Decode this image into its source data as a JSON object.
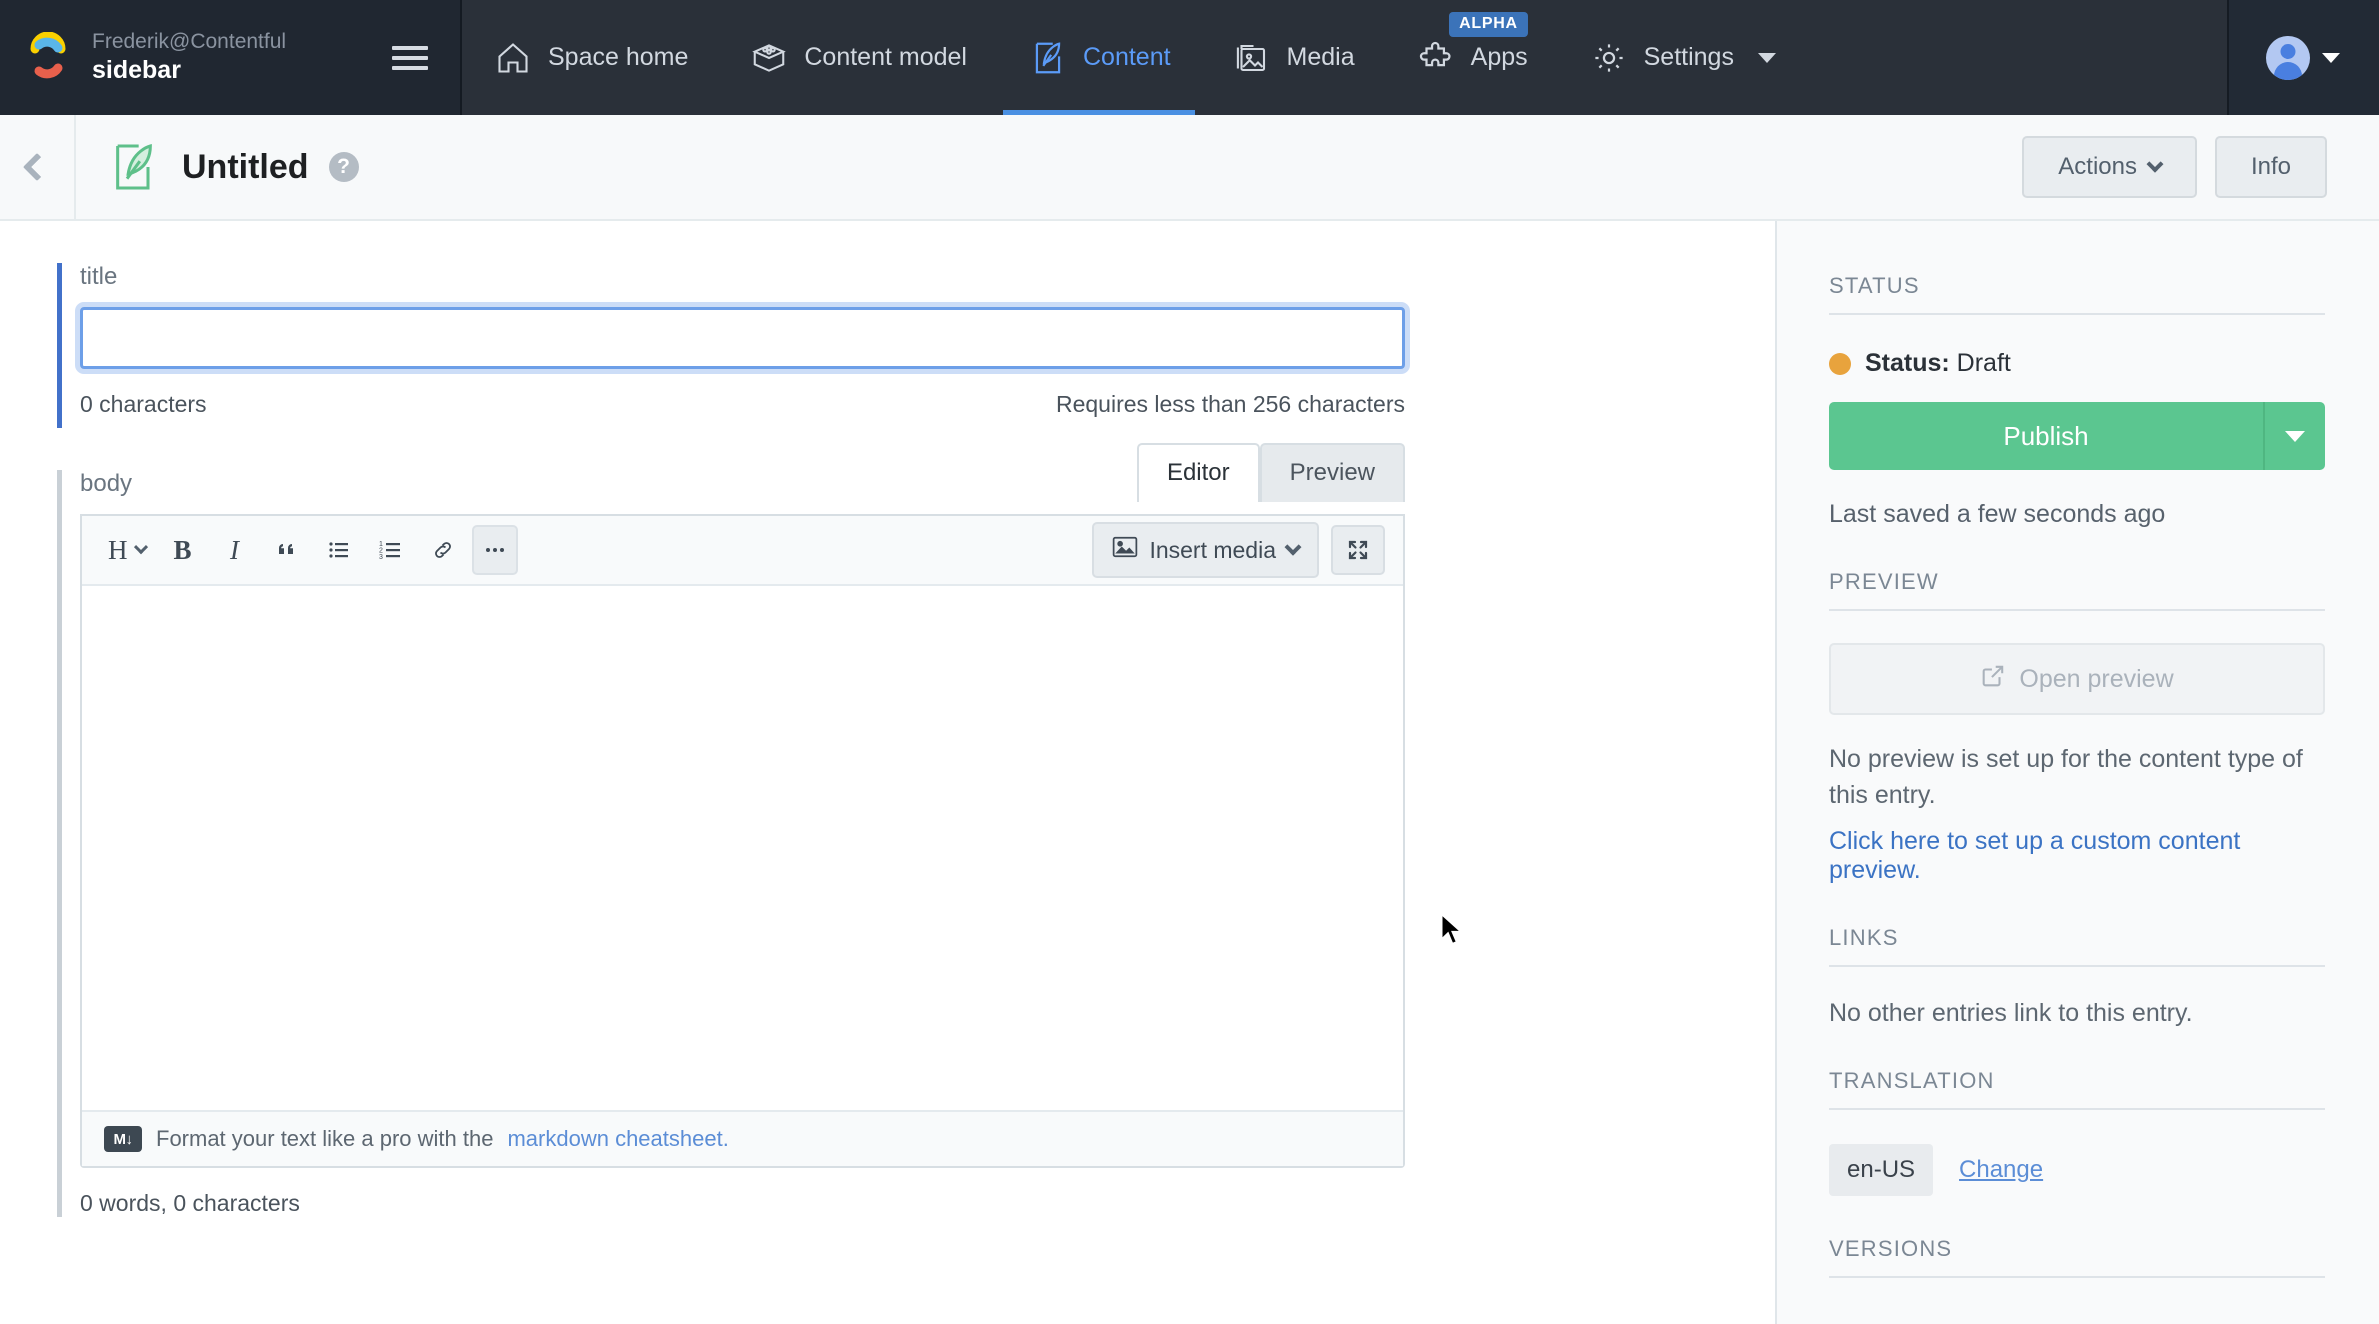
{
  "topnav": {
    "org_label": "Frederik@Contentful",
    "space_name": "sidebar",
    "menu_icon": "hamburger-icon",
    "items": [
      {
        "label": "Space home",
        "icon": "home-icon",
        "active": false
      },
      {
        "label": "Content model",
        "icon": "content-model-icon",
        "active": false
      },
      {
        "label": "Content",
        "icon": "content-entry-icon",
        "active": true
      },
      {
        "label": "Media",
        "icon": "media-icon",
        "active": false
      },
      {
        "label": "Apps",
        "icon": "puzzle-icon",
        "active": false,
        "badge": "ALPHA"
      },
      {
        "label": "Settings",
        "icon": "gear-icon",
        "active": false,
        "caret": true
      }
    ],
    "account": {
      "avatar": "user-avatar-icon",
      "caret": "chevron-down-icon"
    }
  },
  "subheader": {
    "back_icon": "chevron-left-icon",
    "entry_icon": "leaf-entry-icon",
    "title": "Untitled",
    "help_icon": "question-mark-icon",
    "actions_label": "Actions",
    "info_label": "Info"
  },
  "fields": {
    "title": {
      "label": "title",
      "value": "",
      "placeholder": "",
      "char_count": "0 characters",
      "validation": "Requires less than 256 characters"
    },
    "body": {
      "label": "body",
      "tabs": [
        {
          "label": "Editor",
          "active": true
        },
        {
          "label": "Preview",
          "active": false
        }
      ],
      "toolbar": [
        {
          "name": "heading-dropdown",
          "glyph": "H"
        },
        {
          "name": "bold-button",
          "glyph": "B"
        },
        {
          "name": "italic-button",
          "glyph": "I"
        },
        {
          "name": "quote-button",
          "glyph": "“"
        },
        {
          "name": "unordered-list-button",
          "glyph": "☰"
        },
        {
          "name": "ordered-list-button",
          "glyph": "☷"
        },
        {
          "name": "link-button",
          "glyph": "⚭"
        },
        {
          "name": "more-options-button",
          "glyph": "•••"
        }
      ],
      "insert_media_label": "Insert media",
      "expand_icon": "expand-arrows-icon",
      "content": "",
      "footer_prefix": "Format your text like a pro with the ",
      "footer_link": "markdown cheatsheet.",
      "footer_badge": "M↓",
      "word_count": "0 words, 0 characters"
    }
  },
  "sidebar": {
    "status": {
      "heading": "STATUS",
      "label_bold": "Status:",
      "label_value": " Draft",
      "dot_color": "#e8a33d",
      "publish_label": "Publish",
      "publish_color": "#5bc690",
      "publish_caret": "chevron-down-icon",
      "saved_text": "Last saved a few seconds ago"
    },
    "preview": {
      "heading": "PREVIEW",
      "open_label": "Open preview",
      "open_icon": "external-link-icon",
      "description": "No preview is set up for the content type of this entry.",
      "link": "Click here to set up a custom content preview."
    },
    "links": {
      "heading": "LINKS",
      "empty_text": "No other entries link to this entry."
    },
    "translation": {
      "heading": "TRANSLATION",
      "locale": "en-US",
      "change_label": "Change"
    },
    "versions": {
      "heading": "VERSIONS"
    }
  }
}
